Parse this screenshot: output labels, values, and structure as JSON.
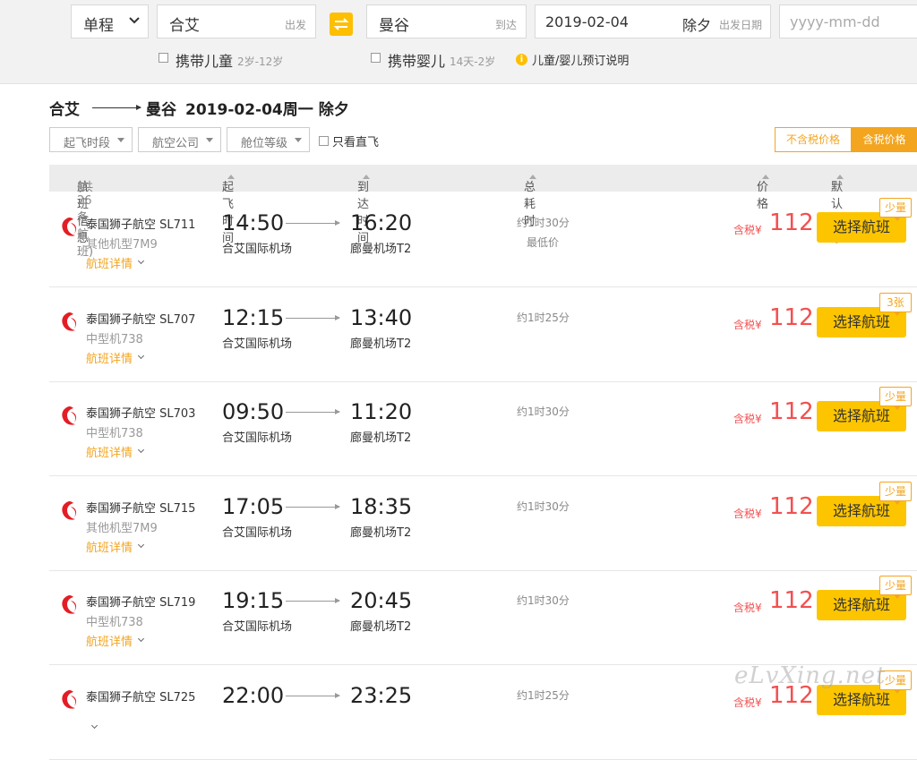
{
  "search": {
    "trip_type": "单程",
    "from_city": "合艾",
    "from_tag": "出发",
    "to_city": "曼谷",
    "to_tag": "到达",
    "depart_date": "2019-02-04",
    "depart_holiday": "除夕",
    "depart_tag": "出发日期",
    "return_placeholder": "yyyy-mm-dd",
    "child_label": "携带儿童",
    "child_age": "2岁-12岁",
    "infant_label": "携带婴儿",
    "infant_age": "14天-2岁",
    "booking_note": "儿童/婴儿预订说明"
  },
  "route": {
    "from": "合艾",
    "to": "曼谷",
    "date": "2019-02-04周一",
    "holiday": "除夕"
  },
  "filters": {
    "depart_time": "起飞时段",
    "airline": "航空公司",
    "cabin": "舱位等级",
    "direct_only": "只看直飞",
    "tax_excluded": "不含税价格",
    "tax_included": "含税价格"
  },
  "table_header": {
    "flight_info": "航班信息",
    "flight_count": "(共26条航班)",
    "depart_time": "起飞时间",
    "arrive_time": "到达时间",
    "duration": "总耗时",
    "price": "价格",
    "sort": "默认排序"
  },
  "flights": [
    {
      "airline": "泰国狮子航空 SL711",
      "model": "其他机型7M9",
      "detail": "航班详情",
      "dep": "14:50",
      "dep_airport": "合艾国际机场",
      "arr": "16:20",
      "arr_airport": "廊曼机场T2",
      "duration": "约1时30分",
      "tag": "最低价",
      "price_label": "含税¥",
      "price": "112",
      "select": "选择航班",
      "badge": "少量"
    },
    {
      "airline": "泰国狮子航空 SL707",
      "model": "中型机738",
      "detail": "航班详情",
      "dep": "12:15",
      "dep_airport": "合艾国际机场",
      "arr": "13:40",
      "arr_airport": "廊曼机场T2",
      "duration": "约1时25分",
      "tag": "",
      "price_label": "含税¥",
      "price": "112",
      "select": "选择航班",
      "badge": "3张"
    },
    {
      "airline": "泰国狮子航空 SL703",
      "model": "中型机738",
      "detail": "航班详情",
      "dep": "09:50",
      "dep_airport": "合艾国际机场",
      "arr": "11:20",
      "arr_airport": "廊曼机场T2",
      "duration": "约1时30分",
      "tag": "",
      "price_label": "含税¥",
      "price": "112",
      "select": "选择航班",
      "badge": "少量"
    },
    {
      "airline": "泰国狮子航空 SL715",
      "model": "其他机型7M9",
      "detail": "航班详情",
      "dep": "17:05",
      "dep_airport": "合艾国际机场",
      "arr": "18:35",
      "arr_airport": "廊曼机场T2",
      "duration": "约1时30分",
      "tag": "",
      "price_label": "含税¥",
      "price": "112",
      "select": "选择航班",
      "badge": "少量"
    },
    {
      "airline": "泰国狮子航空 SL719",
      "model": "中型机738",
      "detail": "航班详情",
      "dep": "19:15",
      "dep_airport": "合艾国际机场",
      "arr": "20:45",
      "arr_airport": "廊曼机场T2",
      "duration": "约1时30分",
      "tag": "",
      "price_label": "含税¥",
      "price": "112",
      "select": "选择航班",
      "badge": "少量"
    },
    {
      "airline": "泰国狮子航空 SL725",
      "model": "",
      "detail": "",
      "dep": "22:00",
      "dep_airport": "",
      "arr": "23:25",
      "arr_airport": "",
      "duration": "约1时25分",
      "tag": "",
      "price_label": "含税¥",
      "price": "112",
      "select": "选择航班",
      "badge": "少量"
    }
  ],
  "watermark": "eLvXing.net",
  "colors": {
    "accent": "#fdc500",
    "price": "#f25050",
    "orange": "#f3a51f"
  }
}
